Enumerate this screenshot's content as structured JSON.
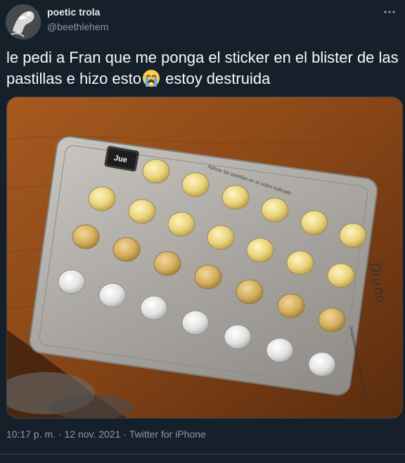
{
  "author": {
    "display_name": "poetic trola",
    "handle": "@beethlehem"
  },
  "tweet": {
    "text_part1": "le pedi a Fran que me ponga el sticker en el blister de las pastillas e hizo esto",
    "emoji": "loudly-crying-face",
    "text_part2": " estoy destruida"
  },
  "photo": {
    "sticker_label": "Jue",
    "pack_text_top": "Aplicar las pastillas en el orden indicado",
    "pack_brand": "Diuna",
    "pack_text_side": "Drospirenona 3 mg Etinilestradiol 0,02 mg"
  },
  "meta": {
    "time": "10:17 p. m.",
    "separator": "·",
    "date": "12 nov. 2021",
    "source": "Twitter for iPhone"
  },
  "colors": {
    "background": "#15202b",
    "text": "#f7f9f9",
    "secondary": "#8b98a5",
    "divider": "#38444d"
  }
}
